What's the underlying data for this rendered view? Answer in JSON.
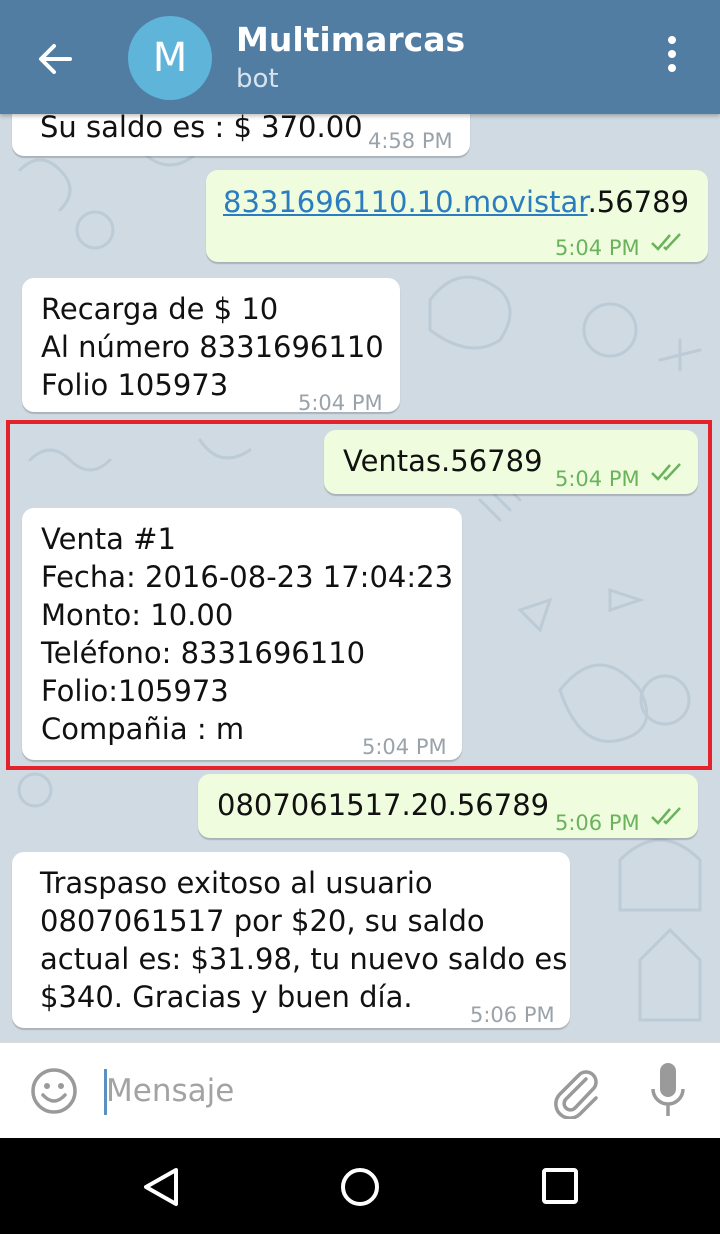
{
  "header": {
    "avatar_letter": "M",
    "title": "Multimarcas",
    "subtitle": "bot"
  },
  "messages": [
    {
      "text": "Su saldo es : $ 370.00",
      "time": "4:58 PM",
      "direction": "incoming"
    },
    {
      "link_text": "8331696110.10.movistar",
      "text_after_link": ".56789",
      "time": "5:04 PM",
      "direction": "outgoing",
      "read": true
    },
    {
      "text": "Recarga de $ 10\nAl número 8331696110\nFolio 105973",
      "time": "5:04 PM",
      "direction": "incoming"
    },
    {
      "text": "Ventas.56789",
      "time": "5:04 PM",
      "direction": "outgoing",
      "read": true
    },
    {
      "text": "Venta #1\nFecha: 2016-08-23 17:04:23\nMonto: 10.00\nTeléfono: 8331696110\nFolio:105973\nCompañia : m",
      "time": "5:04 PM",
      "direction": "incoming"
    },
    {
      "text": "0807061517.20.56789",
      "time": "5:06 PM",
      "direction": "outgoing",
      "read": true
    },
    {
      "text": "Traspaso exitoso al usuario\n0807061517 por $20, su saldo\nactual es: $31.98, tu nuevo saldo es\n$340. Gracias y buen día.",
      "time": "5:06 PM",
      "direction": "incoming"
    }
  ],
  "composer": {
    "placeholder": "Mensaje"
  },
  "icons": {
    "back": "arrow-left-icon",
    "menu": "more-vertical-icon",
    "emoji": "smiley-icon",
    "attach": "paperclip-icon",
    "mic": "microphone-icon",
    "read": "double-check-icon",
    "nav_back": "triangle-back-icon",
    "nav_home": "circle-home-icon",
    "nav_recent": "square-recents-icon"
  },
  "colors": {
    "header": "#527da3",
    "chat_background": "#cfdae2",
    "outgoing_bubble": "#effdde",
    "incoming_bubble": "#ffffff",
    "highlight_border": "#e4222b",
    "checkmarks": "#6ab35c"
  }
}
